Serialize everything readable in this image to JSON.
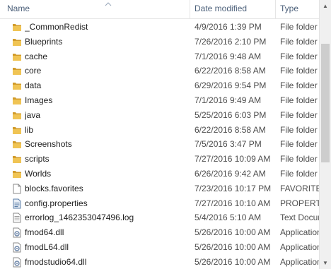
{
  "columns": {
    "name": "Name",
    "date": "Date modified",
    "type": "Type"
  },
  "files": [
    {
      "name": "_CommonRedist",
      "date": "4/9/2016 1:39 PM",
      "type": "File folder",
      "icon": "folder-icon"
    },
    {
      "name": "Blueprints",
      "date": "7/26/2016 2:10 PM",
      "type": "File folder",
      "icon": "folder-icon"
    },
    {
      "name": "cache",
      "date": "7/1/2016 9:48 AM",
      "type": "File folder",
      "icon": "folder-icon"
    },
    {
      "name": "core",
      "date": "6/22/2016 8:58 AM",
      "type": "File folder",
      "icon": "folder-icon"
    },
    {
      "name": "data",
      "date": "6/29/2016 9:54 PM",
      "type": "File folder",
      "icon": "folder-icon"
    },
    {
      "name": "Images",
      "date": "7/1/2016 9:49 AM",
      "type": "File folder",
      "icon": "folder-icon"
    },
    {
      "name": "java",
      "date": "5/25/2016 6:03 PM",
      "type": "File folder",
      "icon": "folder-icon"
    },
    {
      "name": "lib",
      "date": "6/22/2016 8:58 AM",
      "type": "File folder",
      "icon": "folder-icon"
    },
    {
      "name": "Screenshots",
      "date": "7/5/2016 3:47 PM",
      "type": "File folder",
      "icon": "folder-icon"
    },
    {
      "name": "scripts",
      "date": "7/27/2016 10:09 AM",
      "type": "File folder",
      "icon": "folder-icon"
    },
    {
      "name": "Worlds",
      "date": "6/26/2016 9:42 AM",
      "type": "File folder",
      "icon": "folder-icon"
    },
    {
      "name": "blocks.favorites",
      "date": "7/23/2016 10:17 PM",
      "type": "FAVORITES File",
      "icon": "blank-file-icon"
    },
    {
      "name": "config.properties",
      "date": "7/27/2016 10:10 AM",
      "type": "PROPERTIES File",
      "icon": "properties-file-icon"
    },
    {
      "name": "errorlog_1462353047496.log",
      "date": "5/4/2016 5:10 AM",
      "type": "Text Document",
      "icon": "text-file-icon"
    },
    {
      "name": "fmod64.dll",
      "date": "5/26/2016 10:00 AM",
      "type": "Application extension",
      "icon": "dll-file-icon"
    },
    {
      "name": "fmodL64.dll",
      "date": "5/26/2016 10:00 AM",
      "type": "Application extension",
      "icon": "dll-file-icon"
    },
    {
      "name": "fmodstudio64.dll",
      "date": "5/26/2016 10:00 AM",
      "type": "Application extension",
      "icon": "dll-file-icon"
    }
  ],
  "colors": {
    "header_text": "#4c607a",
    "folder": "#e8b84a",
    "folder_dark": "#d29c2c"
  }
}
